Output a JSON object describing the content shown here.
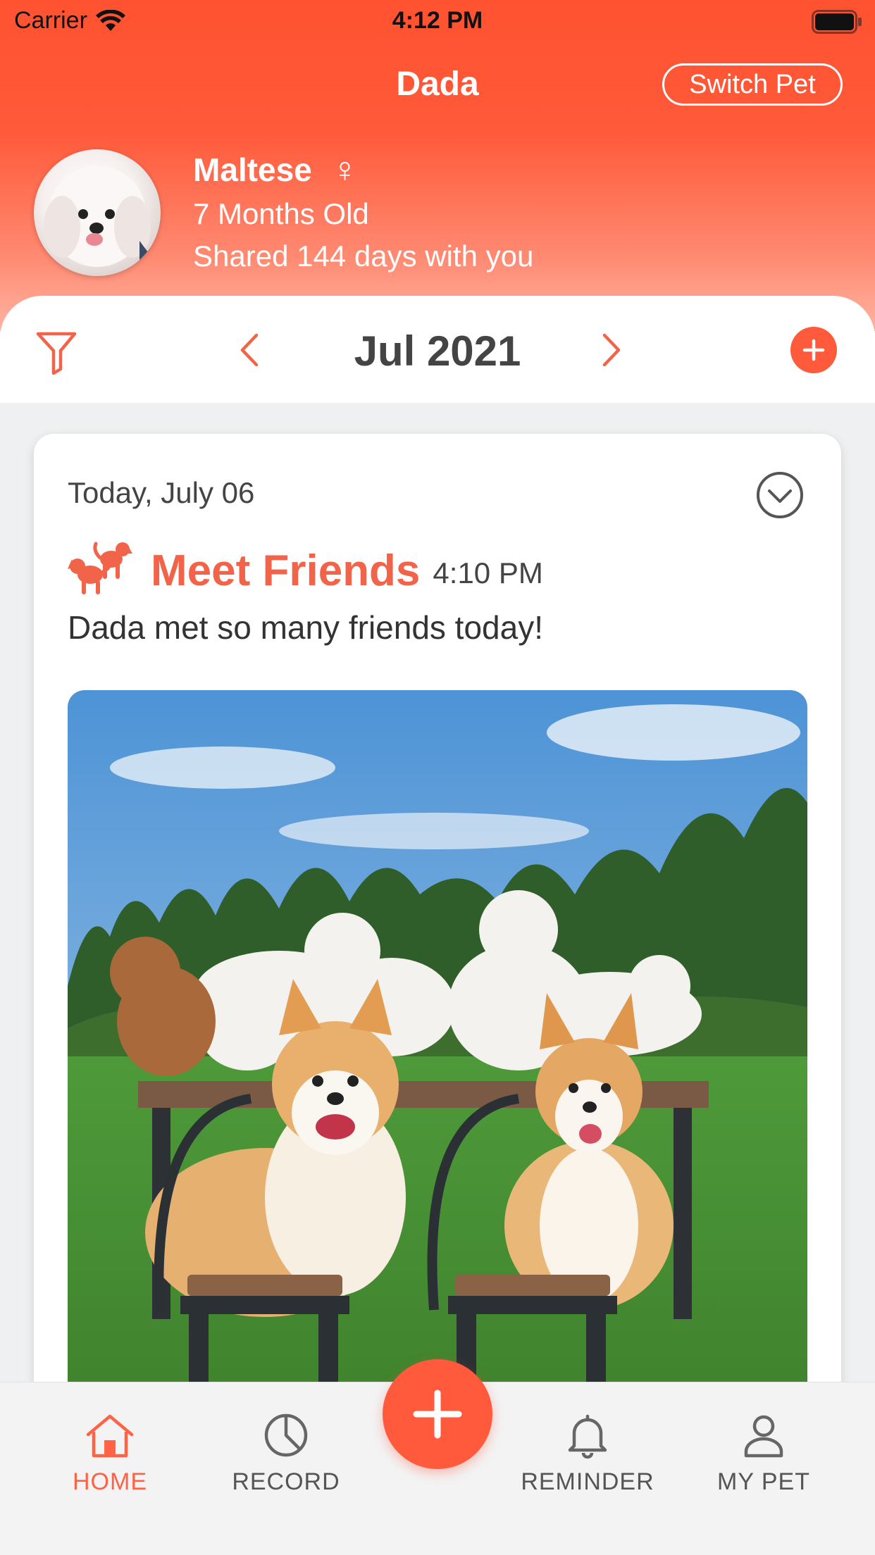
{
  "status_bar": {
    "carrier": "Carrier",
    "time": "4:12 PM"
  },
  "header": {
    "title": "Dada",
    "switch_pet_label": "Switch Pet"
  },
  "pet": {
    "breed": "Maltese",
    "gender_symbol": "♀",
    "age": "7 Months Old",
    "shared": "Shared 144 days with you"
  },
  "month_nav": {
    "label": "Jul 2021"
  },
  "entry": {
    "date": "Today, July 06",
    "title": "Meet Friends",
    "time": "4:10 PM",
    "description": "Dada met so many friends today!"
  },
  "tabs": [
    {
      "label": "HOME",
      "icon": "home-icon",
      "active": true
    },
    {
      "label": "RECORD",
      "icon": "pie-chart-icon",
      "active": false
    },
    {
      "label": "REMINDER",
      "icon": "bell-icon",
      "active": false
    },
    {
      "label": "MY PET",
      "icon": "user-icon",
      "active": false
    }
  ],
  "colors": {
    "accent": "#ff5a3c",
    "header_top": "#ff5230",
    "header_bottom": "#ffb3a3",
    "event_title": "#f2644a",
    "background": "#eef0f1"
  }
}
